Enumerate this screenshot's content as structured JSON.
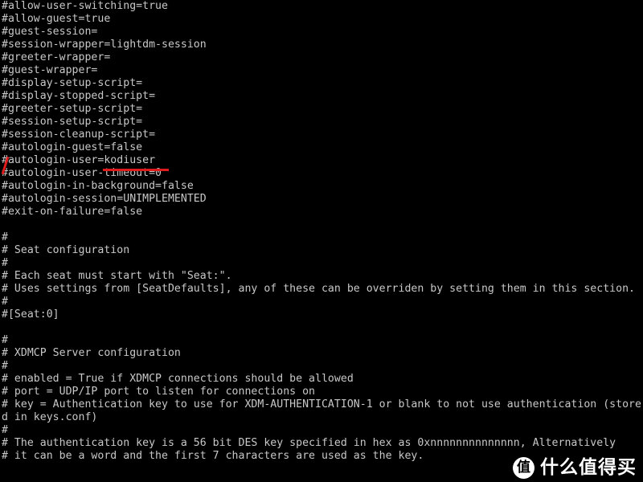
{
  "terminal": {
    "background_color": "#000000",
    "text_color": "#c8c8c8",
    "annotation_color": "#e01b1b",
    "lines": [
      "#allow-user-switching=true",
      "#allow-guest=true",
      "#guest-session=",
      "#session-wrapper=lightdm-session",
      "#greeter-wrapper=",
      "#guest-wrapper=",
      "#display-setup-script=",
      "#display-stopped-script=",
      "#greeter-setup-script=",
      "#session-setup-script=",
      "#session-cleanup-script=",
      "#autologin-guest=false",
      "#autologin-user=kodiuser",
      "#autologin-user-timeout=0",
      "#autologin-in-background=false",
      "#autologin-session=UNIMPLEMENTED",
      "#exit-on-failure=false",
      "",
      "#",
      "# Seat configuration",
      "#",
      "# Each seat must start with \"Seat:\".",
      "# Uses settings from [SeatDefaults], any of these can be overriden by setting them in this section.",
      "#",
      "#[Seat:0]",
      "",
      "#",
      "# XDMCP Server configuration",
      "#",
      "# enabled = True if XDMCP connections should be allowed",
      "# port = UDP/IP port to listen for connections on",
      "# key = Authentication key to use for XDM-AUTHENTICATION-1 or blank to not use authentication (store",
      "d in keys.conf)",
      "#",
      "# The authentication key is a 56 bit DES key specified in hex as 0xnnnnnnnnnnnnnn, Alternatively",
      "# it can be a word and the first 7 characters are used as the key."
    ]
  },
  "annotations": {
    "strike_mark": {
      "name": "red-slash-over-hash",
      "target_line_index": 12,
      "color": "#e01b1b"
    },
    "underline": {
      "name": "red-underline-under-kodiuser",
      "target_text": "kodiuser",
      "target_line_index": 12,
      "color": "#e01b1b"
    }
  },
  "watermark": {
    "logo_char": "值",
    "text": "什么值得买"
  }
}
